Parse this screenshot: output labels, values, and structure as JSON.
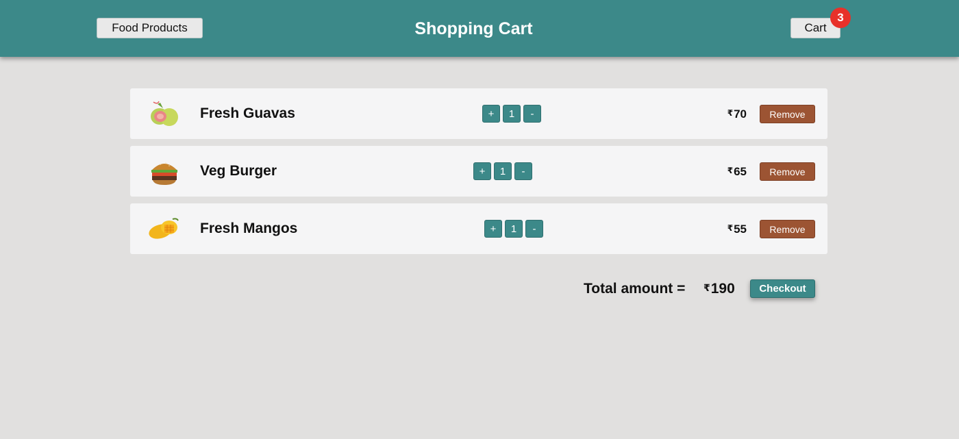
{
  "header": {
    "food_products_label": "Food Products",
    "title": "Shopping Cart",
    "cart_label": "Cart",
    "cart_count": "3"
  },
  "cart": {
    "items": [
      {
        "name": "Fresh Guavas",
        "plus": "+",
        "quantity": "1",
        "minus": "-",
        "currency": "₹",
        "price": "70",
        "remove_label": "Remove",
        "image": "guava-image"
      },
      {
        "name": "Veg Burger",
        "plus": "+",
        "quantity": "1",
        "minus": "-",
        "currency": "₹",
        "price": "65",
        "remove_label": "Remove",
        "image": "burger-image"
      },
      {
        "name": "Fresh Mangos",
        "plus": "+",
        "quantity": "1",
        "minus": "-",
        "currency": "₹",
        "price": "55",
        "remove_label": "Remove",
        "image": "mango-image"
      }
    ],
    "total_label": "Total amount =",
    "total_currency": "₹",
    "total_value": "190",
    "checkout_label": "Checkout"
  },
  "colors": {
    "header": "#3c8989",
    "accent": "#3c8989",
    "remove": "#9c5433",
    "badge": "#e8312a",
    "background": "#e1e0df"
  }
}
